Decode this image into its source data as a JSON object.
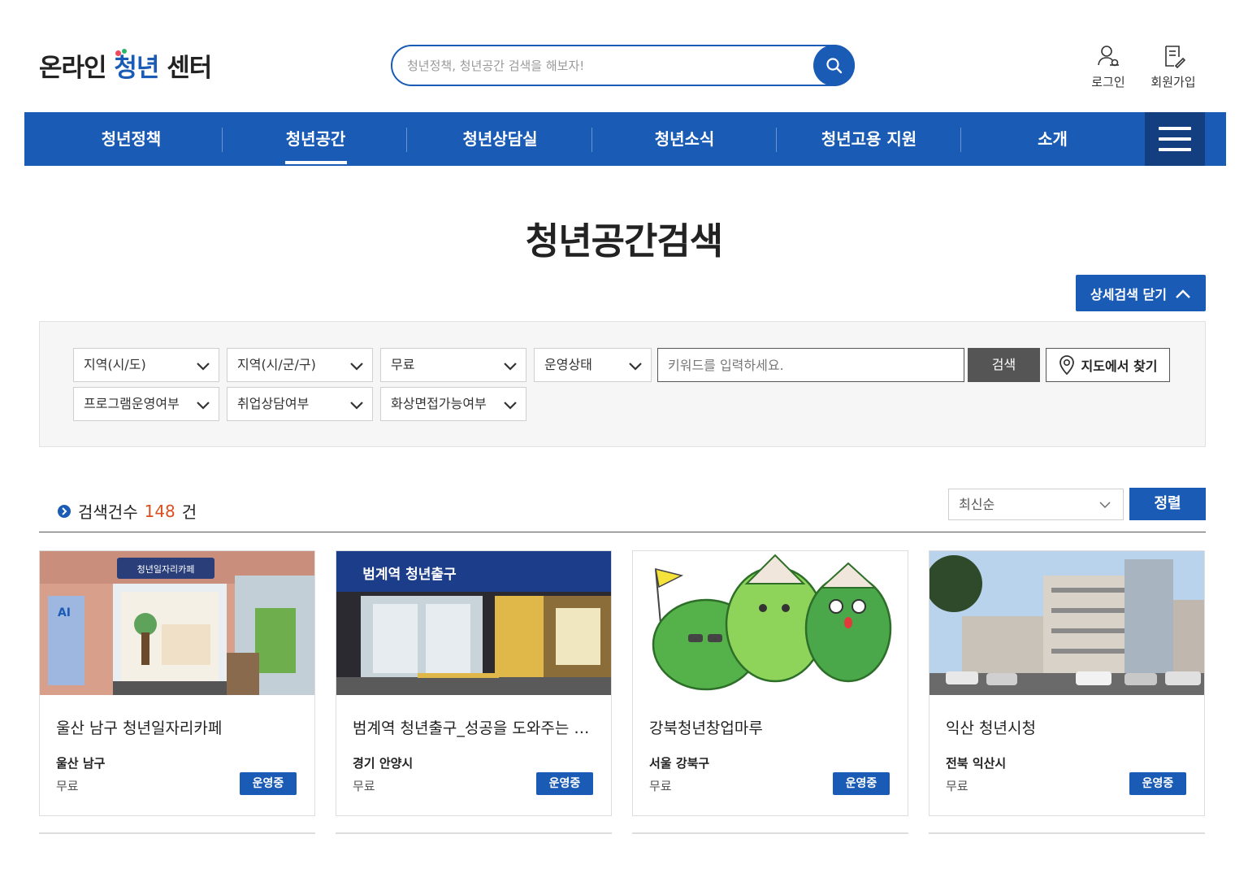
{
  "header": {
    "logo_part1": "온라인",
    "logo_accent": "청년",
    "logo_part2": "센터",
    "search_placeholder": "청년정책, 청년공간 검색을 해보자!",
    "login_label": "로그인",
    "signup_label": "회원가입"
  },
  "nav": {
    "items": [
      "청년정책",
      "청년공간",
      "청년상담실",
      "청년소식",
      "청년고용 지원",
      "소개"
    ],
    "active_index": 1
  },
  "page_title": "청년공간검색",
  "detail_toggle_label": "상세검색 닫기",
  "filters": {
    "region_sido": "지역(시/도)",
    "region_sigungu": "지역(시/군/구)",
    "fee": "무료",
    "status": "운영상태",
    "keyword_placeholder": "키워드를 입력하세요.",
    "search_button": "검색",
    "map_button": "지도에서 찾기",
    "program": "프로그램운영여부",
    "counseling": "취업상담여부",
    "video_interview": "화상면접가능여부"
  },
  "results": {
    "label": "검색건수",
    "count": "148",
    "unit": "건",
    "sort_selected": "최신순",
    "sort_button": "정렬"
  },
  "cards": [
    {
      "title": "울산 남구 청년일자리카페",
      "region": "울산 남구",
      "fee": "무료",
      "status": "운영중"
    },
    {
      "title": "범계역 청년출구_성공을 도와주는 청년공간",
      "region": "경기 안양시",
      "fee": "무료",
      "status": "운영중"
    },
    {
      "title": "강북청년창업마루",
      "region": "서울 강북구",
      "fee": "무료",
      "status": "운영중"
    },
    {
      "title": "익산 청년시청",
      "region": "전북 익산시",
      "fee": "무료",
      "status": "운영중"
    }
  ],
  "thumb_signs": {
    "card1_sign": "청년일자리카페",
    "card2_sign": "범계역 청년출구"
  },
  "colors": {
    "primary": "#1a5bb5",
    "nav_menu": "#133f80",
    "count_accent": "#d9501e",
    "dark_button": "#555555"
  }
}
